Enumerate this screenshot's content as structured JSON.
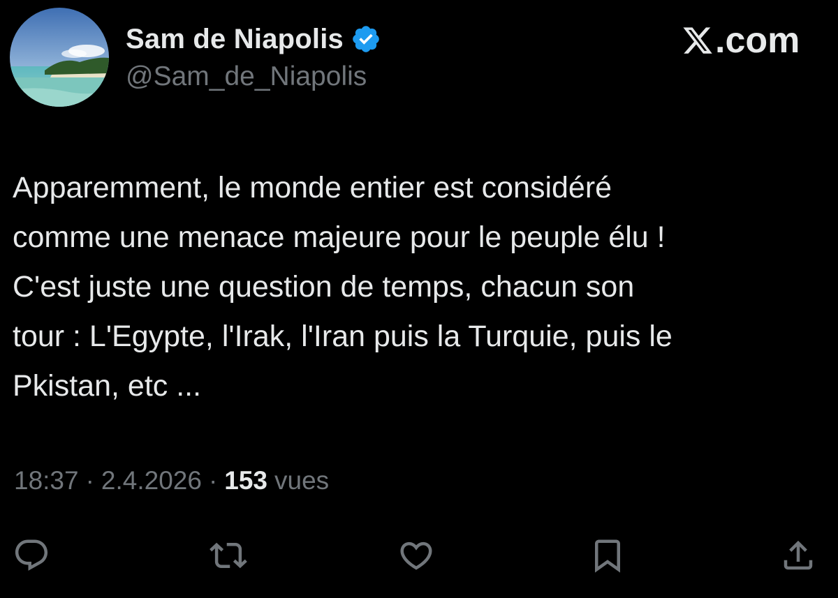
{
  "author": {
    "display_name": "Sam de Niapolis",
    "handle": "@Sam_de_Niapolis",
    "verified": true,
    "avatar_icon": "beach-avatar-icon"
  },
  "brand": {
    "label": ".com",
    "icon": "x-logo-icon"
  },
  "tweet": {
    "text": "Apparemment, le monde entier est considéré\ncomme une menace majeure pour le peuple élu !\nC'est juste une question de temps, chacun son\ntour : L'Egypte, l'Irak, l'Iran puis la Turquie, puis le\nPkistan, etc ...",
    "time": "18:37",
    "date": "2.4.2026",
    "separator": "·",
    "views_count": "153",
    "views_label": "vues"
  },
  "actions": [
    {
      "name": "reply",
      "icon": "reply-icon"
    },
    {
      "name": "repost",
      "icon": "repost-icon"
    },
    {
      "name": "like",
      "icon": "heart-icon"
    },
    {
      "name": "bookmark",
      "icon": "bookmark-icon"
    },
    {
      "name": "share",
      "icon": "share-icon"
    }
  ],
  "colors": {
    "background": "#000000",
    "text_primary": "#e7e9ea",
    "text_secondary": "#71767b",
    "verified_blue": "#1d9bf0"
  }
}
